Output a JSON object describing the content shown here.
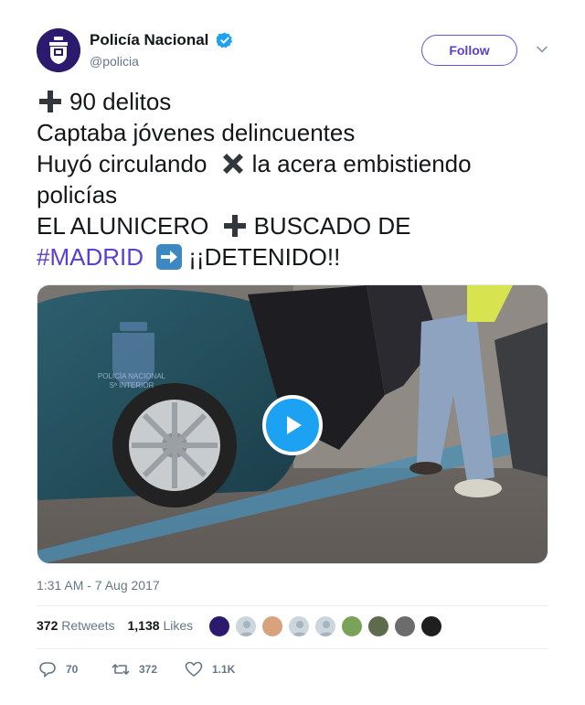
{
  "account": {
    "display_name": "Policía Nacional",
    "handle": "@policia",
    "verified": true,
    "follow_label": "Follow"
  },
  "tweet": {
    "line1": "90 delitos",
    "line2": "Captaba jóvenes delincuentes",
    "line3a": "Huyó circulando",
    "line3b": "la acera embistiendo",
    "line4": "policías",
    "line5a": "EL ALUNICERO",
    "line5b": "BUSCADO DE",
    "hashtag": "#MADRID",
    "line6b": "¡¡DETENIDO!!"
  },
  "media": {
    "type": "video",
    "overlay_text": "POLICÍA NACIONAL\nSª INTERIOR"
  },
  "timestamp": "1:31 AM - 7 Aug 2017",
  "stats": {
    "retweets_count": "372",
    "retweets_label": "Retweets",
    "likes_count": "1,138",
    "likes_label": "Likes"
  },
  "actions": {
    "replies": "70",
    "retweets": "372",
    "likes": "1.1K"
  },
  "colors": {
    "accent": "#5b3fd1",
    "verified": "#1da1f2",
    "text": "#14171a",
    "muted": "#657786"
  },
  "icons": [
    "police-badge-logo",
    "verified-icon",
    "chevron-down-icon",
    "heavy-plus-emoji",
    "cross-mark-emoji",
    "right-arrow-emoji",
    "play-icon",
    "reply-icon",
    "retweet-icon",
    "like-icon"
  ]
}
